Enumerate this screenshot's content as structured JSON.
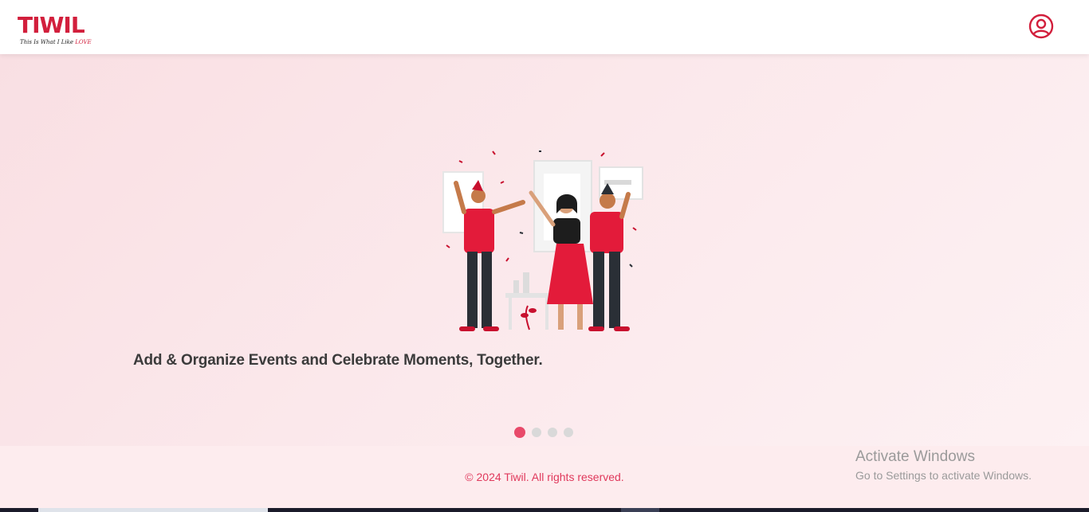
{
  "header": {
    "logo_text": "TIWIL",
    "logo_tagline_prefix": "This Is What I Like",
    "logo_tagline_love": "LOVE",
    "profile_icon": "user-circle-icon"
  },
  "hero": {
    "illustration": "party-celebration-illustration",
    "caption": "Add & Organize Events and Celebrate Moments, Together.",
    "slides_total": 4,
    "active_slide": 1
  },
  "footer": {
    "copyright": "© 2024 Tiwil. All rights reserved."
  },
  "watermark": {
    "title": "Activate Windows",
    "subtitle": "Go to Settings to activate Windows."
  },
  "colors": {
    "brand": "#d21f3c",
    "accent": "#e84a6a",
    "text_dark": "#3b3b3b"
  }
}
